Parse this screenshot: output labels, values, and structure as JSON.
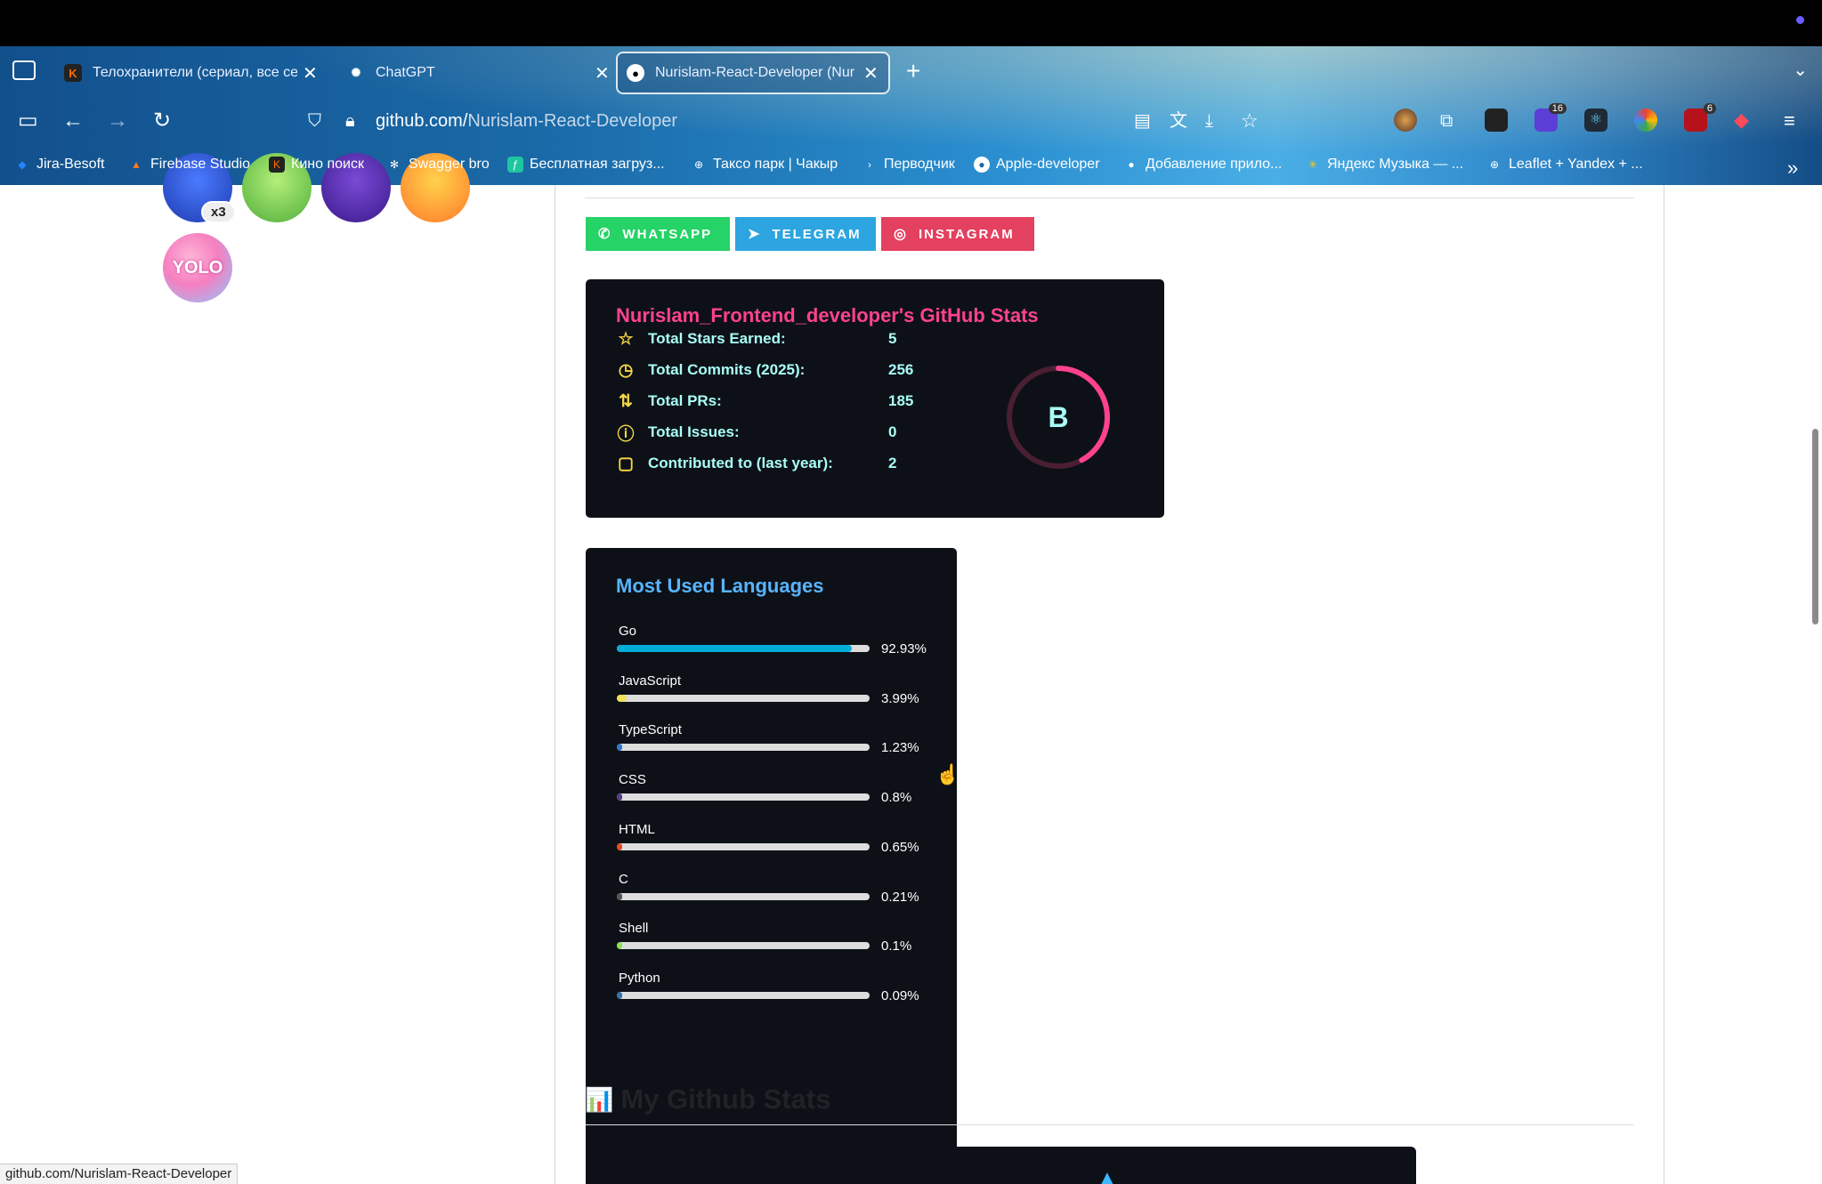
{
  "browser": {
    "tabs": [
      {
        "title": "Телохранители (сериал, все се",
        "active": false
      },
      {
        "title": "ChatGPT",
        "active": false
      },
      {
        "title": "Nurislam-React-Developer (Nur",
        "active": true
      }
    ],
    "url_host": "github.com/",
    "url_path": "Nurislam-React-Developer",
    "extension_badges": [
      "16",
      "6"
    ],
    "bookmarks": [
      {
        "label": "Jira-Besoft"
      },
      {
        "label": "Firebase Studio"
      },
      {
        "label": "Кино поиск"
      },
      {
        "label": "Swagger bro"
      },
      {
        "label": "Бесплатная загруз..."
      },
      {
        "label": "Таксо парк | Чакыр"
      },
      {
        "label": "Перводчик"
      },
      {
        "label": "Apple-developer"
      },
      {
        "label": "Добавление прило..."
      },
      {
        "label": "Яндекс Музыка — ..."
      },
      {
        "label": "Leaflet + Yandex + ..."
      }
    ]
  },
  "sidebar": {
    "achievement_badge": "x3",
    "yolo": "YOLO"
  },
  "social": [
    {
      "label": "WHATSAPP",
      "color": "#25D366",
      "icon": "whatsapp-icon"
    },
    {
      "label": "TELEGRAM",
      "color": "#2CA5E0",
      "icon": "telegram-icon"
    },
    {
      "label": "INSTAGRAM",
      "color": "#E4405F",
      "icon": "instagram-icon"
    }
  ],
  "stats_card": {
    "title": "Nurislam_Frontend_developer's GitHub Stats",
    "rows": [
      {
        "label": "Total Stars Earned:",
        "value": "5",
        "icon": "star-icon"
      },
      {
        "label": "Total Commits (2025):",
        "value": "256",
        "icon": "history-icon"
      },
      {
        "label": "Total PRs:",
        "value": "185",
        "icon": "pull-request-icon"
      },
      {
        "label": "Total Issues:",
        "value": "0",
        "icon": "issue-icon"
      },
      {
        "label": "Contributed to (last year):",
        "value": "2",
        "icon": "repo-icon"
      }
    ],
    "rank": "B",
    "rank_progress": 0.42,
    "colors": {
      "title": "#fe428e",
      "text": "#a9fef7",
      "icon": "#f8d847",
      "bg": "#0d1117"
    }
  },
  "languages_card": {
    "title": "Most Used Languages",
    "languages": [
      {
        "name": "Go",
        "percent": "92.93%",
        "value": 92.93,
        "color": "#00ADD8"
      },
      {
        "name": "JavaScript",
        "percent": "3.99%",
        "value": 3.99,
        "color": "#f1e05a"
      },
      {
        "name": "TypeScript",
        "percent": "1.23%",
        "value": 1.23,
        "color": "#3178c6"
      },
      {
        "name": "CSS",
        "percent": "0.8%",
        "value": 0.8,
        "color": "#563d7c"
      },
      {
        "name": "HTML",
        "percent": "0.65%",
        "value": 0.65,
        "color": "#e34c26"
      },
      {
        "name": "C",
        "percent": "0.21%",
        "value": 0.21,
        "color": "#555555"
      },
      {
        "name": "Shell",
        "percent": "0.1%",
        "value": 0.1,
        "color": "#89e051"
      },
      {
        "name": "Python",
        "percent": "0.09%",
        "value": 0.09,
        "color": "#3572A5"
      }
    ]
  },
  "section": {
    "emoji": "📊",
    "heading": "My Github Stats"
  },
  "status_url": "github.com/Nurislam-React-Developer"
}
